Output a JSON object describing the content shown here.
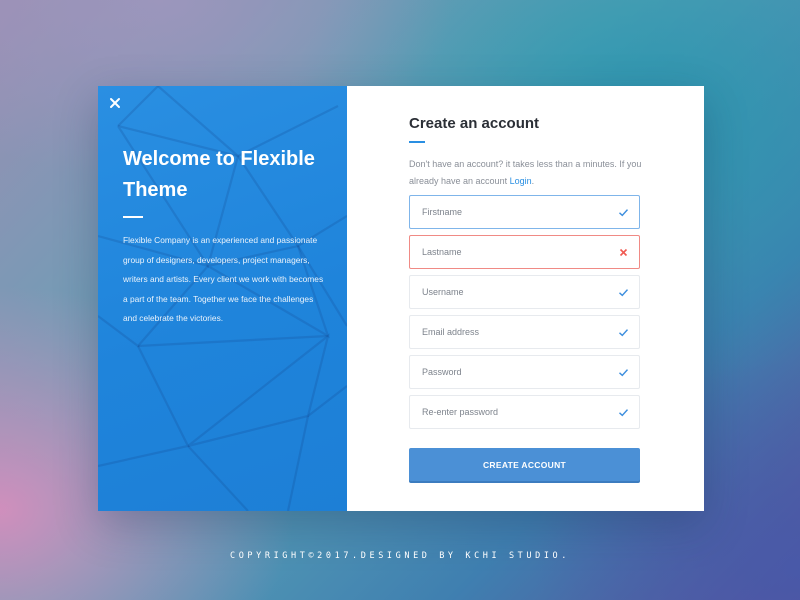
{
  "panel": {
    "heading": "Welcome to Flexible Theme",
    "description": "Flexible Company is an experienced and passionate group of designers, developers, project managers, writers and artists. Every client we work with becomes a part of the team. Together we face the challenges and celebrate the victories."
  },
  "form": {
    "title": "Create an account",
    "subtitle": "Don't have an account? it takes less than a minutes. If you already have an account",
    "login_link": "Login",
    "login_suffix": ".",
    "fields": [
      {
        "placeholder": "Firstname",
        "status": "valid"
      },
      {
        "placeholder": "Lastname",
        "status": "invalid"
      },
      {
        "placeholder": "Username",
        "status": "valid"
      },
      {
        "placeholder": "Email address",
        "status": "valid"
      },
      {
        "placeholder": "Password",
        "status": "valid"
      },
      {
        "placeholder": "Re-enter password",
        "status": "valid"
      }
    ],
    "submit_label": "CREATE ACCOUNT"
  },
  "footer": {
    "copyright": "COPYRIGHT©2017.DESIGNED BY KCHI STUDIO."
  },
  "colors": {
    "accent": "#2a8fe2",
    "button": "#4b90d6",
    "valid": "#3d8ede",
    "invalid": "#f05a52"
  },
  "icons": {
    "close": "close-icon",
    "valid": "check-icon",
    "invalid": "cross-icon"
  }
}
